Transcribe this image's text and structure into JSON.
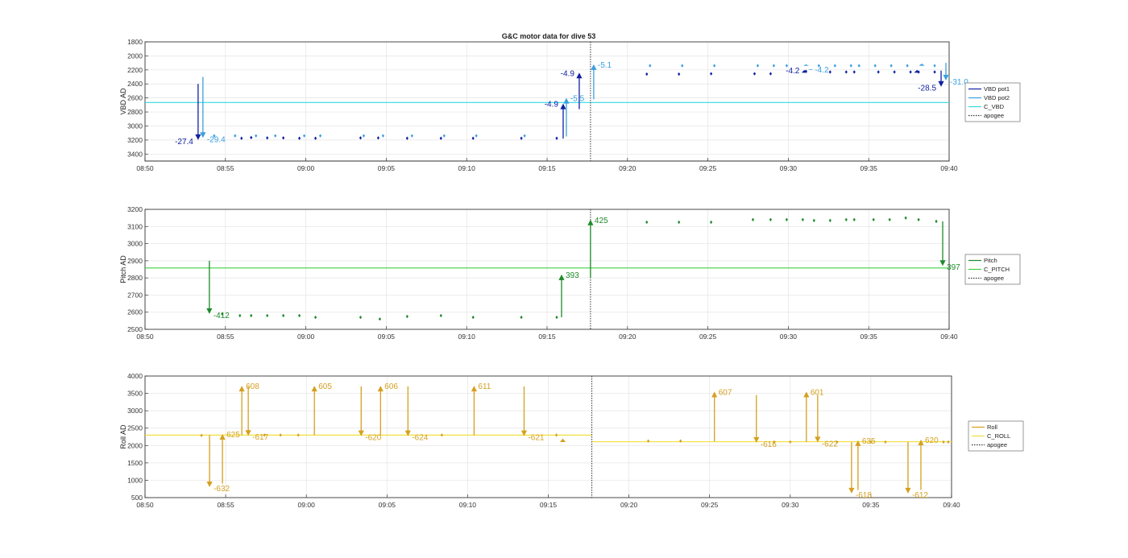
{
  "chart_data": [
    {
      "type": "line",
      "title": "G&C motor data for dive 53",
      "ylabel": "VBD AD",
      "xlim": [
        "08:50",
        "09:40"
      ],
      "ylim": [
        1800,
        3500
      ],
      "y_reversed": true,
      "xticks": [
        "08:50",
        "08:55",
        "09:00",
        "09:05",
        "09:10",
        "09:15",
        "09:20",
        "09:25",
        "09:30",
        "09:35",
        "09:40"
      ],
      "yticks": [
        "1800",
        "2000",
        "2200",
        "2400",
        "2600",
        "2800",
        "3000",
        "3200",
        "3400"
      ],
      "grid": true,
      "legend_position": "right",
      "legend": [
        {
          "label": "VBD pot1",
          "color": "#1020a0",
          "style": "solid"
        },
        {
          "label": "VBD pot2",
          "color": "#3aa0e0",
          "style": "solid"
        },
        {
          "label": "C_VBD",
          "color": "#30d8e0",
          "style": "solid"
        },
        {
          "label": "apogee",
          "color": "#333333",
          "style": "dotted"
        }
      ],
      "reference_lines": [
        {
          "name": "C_VBD",
          "y": 2665,
          "color": "#30d8e0"
        },
        {
          "name": "apogee",
          "x": "09:17.7",
          "color": "#333333",
          "vertical": true
        }
      ],
      "series": [
        {
          "name": "VBD pot1",
          "color": "#1020a0",
          "points": [
            [
              "08:56.0",
              3175
            ],
            [
              "08:56.6",
              3165
            ],
            [
              "08:57.6",
              3170
            ],
            [
              "08:58.6",
              3170
            ],
            [
              "08:59.6",
              3175
            ],
            [
              "09:00.6",
              3175
            ],
            [
              "09:03.4",
              3170
            ],
            [
              "09:04.5",
              3170
            ],
            [
              "09:06.3",
              3175
            ],
            [
              "09:08.4",
              3175
            ],
            [
              "09:10.4",
              3175
            ],
            [
              "09:13.4",
              3175
            ],
            [
              "09:15.6",
              3175
            ],
            [
              "09:21.2",
              2260
            ],
            [
              "09:23.2",
              2260
            ],
            [
              "09:25.2",
              2255
            ],
            [
              "09:27.9",
              2255
            ],
            [
              "09:28.9",
              2255
            ],
            [
              "09:31.1",
              2220
            ],
            [
              "09:32.6",
              2230
            ],
            [
              "09:33.6",
              2230
            ],
            [
              "09:34.1",
              2230
            ],
            [
              "09:35.6",
              2230
            ],
            [
              "09:36.6",
              2230
            ],
            [
              "09:37.6",
              2230
            ],
            [
              "09:38.1",
              2230
            ],
            [
              "09:39.1",
              2230
            ]
          ],
          "arrows": [
            {
              "x": "08:53.3",
              "from": 2400,
              "to": 3200,
              "label": "-27.4",
              "label_side": "left"
            },
            {
              "x": "09:16.0",
              "from": 3180,
              "to": 2680,
              "label": "-4.9",
              "label_side": "left"
            },
            {
              "x": "09:17.0",
              "from": 2760,
              "to": 2240,
              "label": "-4.9",
              "label_side": "left"
            },
            {
              "x": "09:31.0",
              "from": 2240,
              "to": 2200,
              "label": "-4.2",
              "label_side": "left"
            },
            {
              "x": "09:38.0",
              "from": 2240,
              "to": 2200,
              "label": "",
              "label_side": "left"
            },
            {
              "x": "09:39.5",
              "from": 2210,
              "to": 2440,
              "label": "-28.5",
              "label_side": "left"
            }
          ]
        },
        {
          "name": "VBD pot2",
          "color": "#3aa0e0",
          "points": [
            [
              "08:54.3",
              3140
            ],
            [
              "08:55.6",
              3140
            ],
            [
              "08:56.9",
              3140
            ],
            [
              "08:58.1",
              3140
            ],
            [
              "08:59.9",
              3140
            ],
            [
              "09:00.9",
              3140
            ],
            [
              "09:03.6",
              3140
            ],
            [
              "09:04.8",
              3140
            ],
            [
              "09:06.6",
              3140
            ],
            [
              "09:08.6",
              3140
            ],
            [
              "09:10.6",
              3140
            ],
            [
              "09:13.6",
              3140
            ],
            [
              "09:21.4",
              2140
            ],
            [
              "09:23.4",
              2140
            ],
            [
              "09:25.4",
              2140
            ],
            [
              "09:28.1",
              2140
            ],
            [
              "09:29.1",
              2140
            ],
            [
              "09:29.9",
              2140
            ],
            [
              "09:31.9",
              2140
            ],
            [
              "09:32.9",
              2140
            ],
            [
              "09:33.9",
              2140
            ],
            [
              "09:34.4",
              2140
            ],
            [
              "09:35.4",
              2140
            ],
            [
              "09:36.4",
              2140
            ],
            [
              "09:37.4",
              2140
            ],
            [
              "09:39.1",
              2140
            ]
          ],
          "arrows": [
            {
              "x": "08:53.6",
              "from": 2300,
              "to": 3170,
              "label": "-29.4",
              "label_side": "right"
            },
            {
              "x": "09:16.2",
              "from": 3150,
              "to": 2600,
              "label": "-5.5",
              "label_side": "right"
            },
            {
              "x": "09:17.9",
              "from": 2620,
              "to": 2120,
              "label": "-5.1",
              "label_side": "right"
            },
            {
              "x": "09:31.1",
              "from": 2140,
              "to": 2120,
              "label": "",
              "label_side": "right"
            },
            {
              "x": "09:31.4",
              "from": 2200,
              "to": 2190,
              "label": "-4.2",
              "label_side": "right"
            },
            {
              "x": "09:38.3",
              "from": 2140,
              "to": 2110,
              "label": "",
              "label_side": "right"
            },
            {
              "x": "09:39.8",
              "from": 2100,
              "to": 2350,
              "label": "-31.0",
              "label_side": "right"
            }
          ]
        }
      ]
    },
    {
      "type": "line",
      "title": "",
      "ylabel": "Pitch AD",
      "xlim": [
        "08:50",
        "09:40"
      ],
      "ylim": [
        2500,
        3200
      ],
      "xticks": [
        "08:50",
        "08:55",
        "09:00",
        "09:05",
        "09:10",
        "09:15",
        "09:20",
        "09:25",
        "09:30",
        "09:35",
        "09:40"
      ],
      "yticks": [
        "2500",
        "2600",
        "2700",
        "2800",
        "2900",
        "3000",
        "3100",
        "3200"
      ],
      "grid": true,
      "legend_position": "right",
      "legend": [
        {
          "label": "Pitch",
          "color": "#1f8a2a",
          "style": "solid"
        },
        {
          "label": "C_PITCH",
          "color": "#40d040",
          "style": "solid"
        },
        {
          "label": "apogee",
          "color": "#333333",
          "style": "dotted"
        }
      ],
      "reference_lines": [
        {
          "name": "C_PITCH",
          "y": 2858,
          "color": "#40d040"
        },
        {
          "name": "apogee",
          "x": "09:17.7",
          "color": "#333333",
          "vertical": true
        }
      ],
      "series": [
        {
          "name": "Pitch",
          "color": "#1f8a2a",
          "points": [
            [
              "08:54.8",
              2590
            ],
            [
              "08:55.9",
              2580
            ],
            [
              "08:56.6",
              2580
            ],
            [
              "08:57.6",
              2580
            ],
            [
              "08:58.6",
              2580
            ],
            [
              "08:59.6",
              2580
            ],
            [
              "09:00.6",
              2570
            ],
            [
              "09:03.4",
              2570
            ],
            [
              "09:04.6",
              2560
            ],
            [
              "09:06.3",
              2575
            ],
            [
              "09:08.4",
              2580
            ],
            [
              "09:10.4",
              2570
            ],
            [
              "09:13.4",
              2570
            ],
            [
              "09:15.6",
              2570
            ],
            [
              "09:21.2",
              3125
            ],
            [
              "09:23.2",
              3125
            ],
            [
              "09:25.2",
              3125
            ],
            [
              "09:27.8",
              3140
            ],
            [
              "09:28.9",
              3140
            ],
            [
              "09:29.9",
              3140
            ],
            [
              "09:30.9",
              3140
            ],
            [
              "09:31.6",
              3135
            ],
            [
              "09:32.6",
              3135
            ],
            [
              "09:33.6",
              3140
            ],
            [
              "09:34.1",
              3140
            ],
            [
              "09:35.3",
              3140
            ],
            [
              "09:36.3",
              3140
            ],
            [
              "09:37.3",
              3150
            ],
            [
              "09:38.1",
              3140
            ],
            [
              "09:39.2",
              3130
            ]
          ],
          "arrows": [
            {
              "x": "08:54.0",
              "from": 2900,
              "to": 2590,
              "label": "-412",
              "label_side": "right"
            },
            {
              "x": "09:15.9",
              "from": 2570,
              "to": 2820,
              "label": "393",
              "label_side": "right"
            },
            {
              "x": "09:17.7",
              "from": 2800,
              "to": 3140,
              "label": "425",
              "label_side": "right"
            },
            {
              "x": "09:39.6",
              "from": 3130,
              "to": 2870,
              "label": "397",
              "label_side": "right"
            }
          ]
        }
      ]
    },
    {
      "type": "line",
      "title": "",
      "ylabel": "Roll AD",
      "xlim": [
        "08:50",
        "09:40"
      ],
      "ylim": [
        500,
        4000
      ],
      "xticks": [
        "08:50",
        "08:55",
        "09:00",
        "09:05",
        "09:10",
        "09:15",
        "09:20",
        "09:25",
        "09:30",
        "09:35",
        "09:40"
      ],
      "yticks": [
        "500",
        "1000",
        "1500",
        "2000",
        "2500",
        "3000",
        "3500",
        "4000"
      ],
      "grid": true,
      "legend_position": "right",
      "legend": [
        {
          "label": "Roll",
          "color": "#d4a020",
          "style": "solid"
        },
        {
          "label": "C_ROLL",
          "color": "#f0e040",
          "style": "solid"
        },
        {
          "label": "apogee",
          "color": "#333333",
          "style": "dotted"
        }
      ],
      "reference_lines": [
        {
          "name": "C_ROLL (descent)",
          "y": 2300,
          "x_range": [
            "08:50",
            "09:17.7"
          ],
          "color": "#f0e040"
        },
        {
          "name": "C_ROLL (ascent)",
          "y": 2110,
          "x_range": [
            "09:17.7",
            "09:40"
          ],
          "color": "#f0e040"
        },
        {
          "name": "apogee",
          "x": "09:17.7",
          "color": "#333333",
          "vertical": true
        }
      ],
      "series": [
        {
          "name": "Roll",
          "color": "#d4a020",
          "points": [
            [
              "08:53.5",
              2290
            ],
            [
              "08:57.4",
              2300
            ],
            [
              "08:58.4",
              2300
            ],
            [
              "08:59.5",
              2300
            ],
            [
              "09:08.4",
              2300
            ],
            [
              "09:15.5",
              2300
            ],
            [
              "09:21.2",
              2130
            ],
            [
              "09:23.2",
              2130
            ],
            [
              "09:29.0",
              2100
            ],
            [
              "09:30.0",
              2100
            ],
            [
              "09:32.9",
              2100
            ],
            [
              "09:35.0",
              2100
            ],
            [
              "09:35.9",
              2100
            ],
            [
              "09:39.5",
              2100
            ],
            [
              "09:39.8",
              2100
            ]
          ],
          "arrows": [
            {
              "x": "08:54.0",
              "from": 2300,
              "to": 800,
              "label": "-632",
              "label_side": "right"
            },
            {
              "x": "08:54.8",
              "from": 900,
              "to": 2330,
              "label": "625",
              "label_side": "right"
            },
            {
              "x": "08:56.0",
              "from": 2300,
              "to": 3720,
              "label": "608",
              "label_side": "right"
            },
            {
              "x": "08:56.4",
              "from": 3700,
              "to": 2280,
              "label": "-617",
              "label_side": "right"
            },
            {
              "x": "09:00.5",
              "from": 2300,
              "to": 3720,
              "label": "605",
              "label_side": "right"
            },
            {
              "x": "09:03.4",
              "from": 3700,
              "to": 2270,
              "label": "-620",
              "label_side": "right"
            },
            {
              "x": "09:04.6",
              "from": 2300,
              "to": 3720,
              "label": "606",
              "label_side": "right"
            },
            {
              "x": "09:06.3",
              "from": 3700,
              "to": 2270,
              "label": "-624",
              "label_side": "right"
            },
            {
              "x": "09:10.4",
              "from": 2300,
              "to": 3720,
              "label": "611",
              "label_side": "right"
            },
            {
              "x": "09:13.5",
              "from": 3700,
              "to": 2270,
              "label": "-621",
              "label_side": "right"
            },
            {
              "x": "09:15.9",
              "from": 2100,
              "to": 2200,
              "label": "",
              "label_side": "right"
            },
            {
              "x": "09:25.3",
              "from": 2120,
              "to": 3550,
              "label": "607",
              "label_side": "right"
            },
            {
              "x": "09:27.9",
              "from": 3450,
              "to": 2080,
              "label": "-616",
              "label_side": "right"
            },
            {
              "x": "09:31.0",
              "from": 2100,
              "to": 3550,
              "label": "601",
              "label_side": "right"
            },
            {
              "x": "09:31.7",
              "from": 3450,
              "to": 2090,
              "label": "-622",
              "label_side": "right"
            },
            {
              "x": "09:33.8",
              "from": 2100,
              "to": 620,
              "label": "-618",
              "label_side": "right"
            },
            {
              "x": "09:34.2",
              "from": 720,
              "to": 2150,
              "label": "635",
              "label_side": "right"
            },
            {
              "x": "09:37.3",
              "from": 2100,
              "to": 620,
              "label": "-612",
              "label_side": "right"
            },
            {
              "x": "09:38.1",
              "from": 720,
              "to": 2170,
              "label": "620",
              "label_side": "right"
            }
          ]
        }
      ]
    }
  ]
}
